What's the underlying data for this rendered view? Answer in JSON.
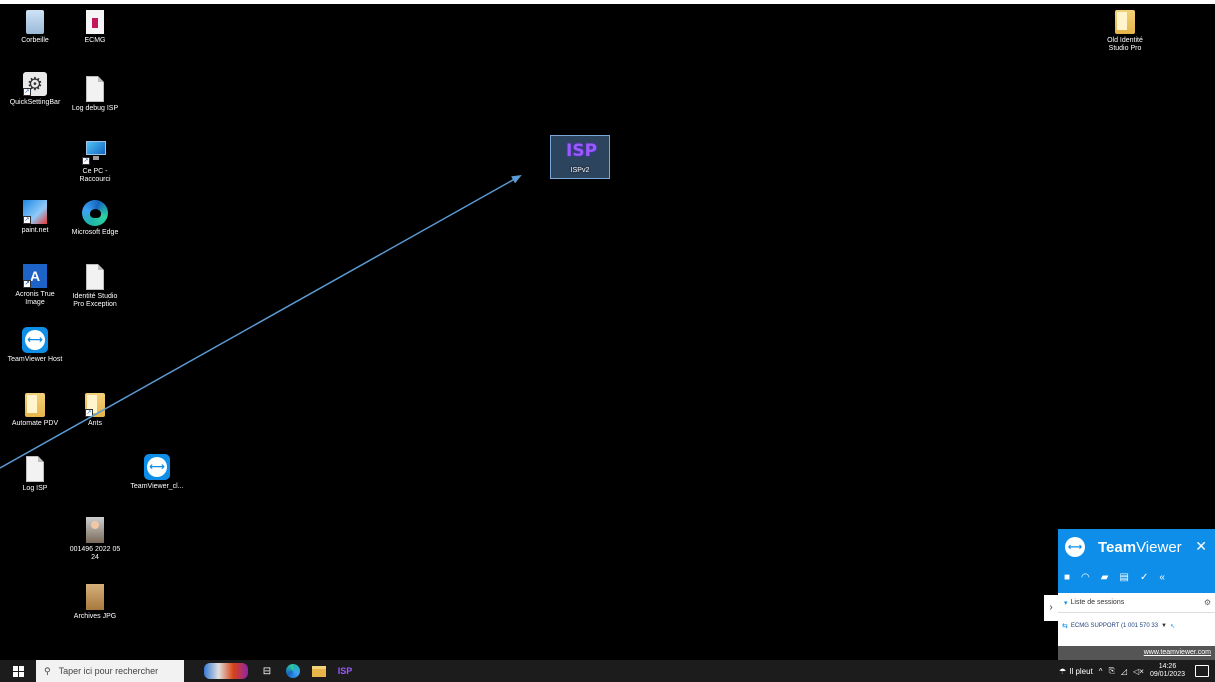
{
  "desktop": {
    "icons": [
      {
        "label": "Corbeille",
        "icon": "recycle-bin-icon"
      },
      {
        "label": "ECMG",
        "icon": "ecmg-icon"
      },
      {
        "label": "QuickSettingBar",
        "icon": "gear-shortcut-icon"
      },
      {
        "label": "Log debug ISP",
        "icon": "document-icon"
      },
      {
        "label": "Ce PC -\nRaccourci",
        "icon": "this-pc-icon"
      },
      {
        "label": "paint.net",
        "icon": "paint-net-icon"
      },
      {
        "label": "Microsoft Edge",
        "icon": "edge-icon"
      },
      {
        "label": "Acronis True\nImage",
        "icon": "acronis-icon"
      },
      {
        "label": "Identité Studio\nPro Exception",
        "icon": "document-icon"
      },
      {
        "label": "TeamViewer Host",
        "icon": "teamviewer-icon"
      },
      {
        "label": "Automate PDV",
        "icon": "folder-icon"
      },
      {
        "label": "Ants",
        "icon": "folder-icon"
      },
      {
        "label": "Log ISP",
        "icon": "document-icon"
      },
      {
        "label": "TeamViewer_cl...",
        "icon": "teamviewer-icon"
      },
      {
        "label": "001496 2022 05\n24",
        "icon": "photo-icon"
      },
      {
        "label": "Archives JPG",
        "icon": "archive-icon"
      },
      {
        "label": "Old Identité\nStudio Pro",
        "icon": "folder-icon"
      },
      {
        "label": "ISPv2",
        "icon": "isp-icon",
        "logo_text": "ISP"
      }
    ],
    "annotation_arrow_color": "#5b9bd5"
  },
  "teamviewer": {
    "title_bold": "Team",
    "title_rest": "Viewer",
    "close": "✕",
    "expand": "›",
    "sessions_header": "Liste de sessions",
    "session_name": "ECMG SUPPORT (1 001 570 33",
    "footer_link": "www.teamviewer.com",
    "brand_color": "#0e8ee9"
  },
  "taskbar": {
    "search_placeholder": "Taper ici pour rechercher",
    "weather": "Il pleut",
    "time": "14:26",
    "date": "09/01/2023",
    "isp_label": "ISP"
  }
}
